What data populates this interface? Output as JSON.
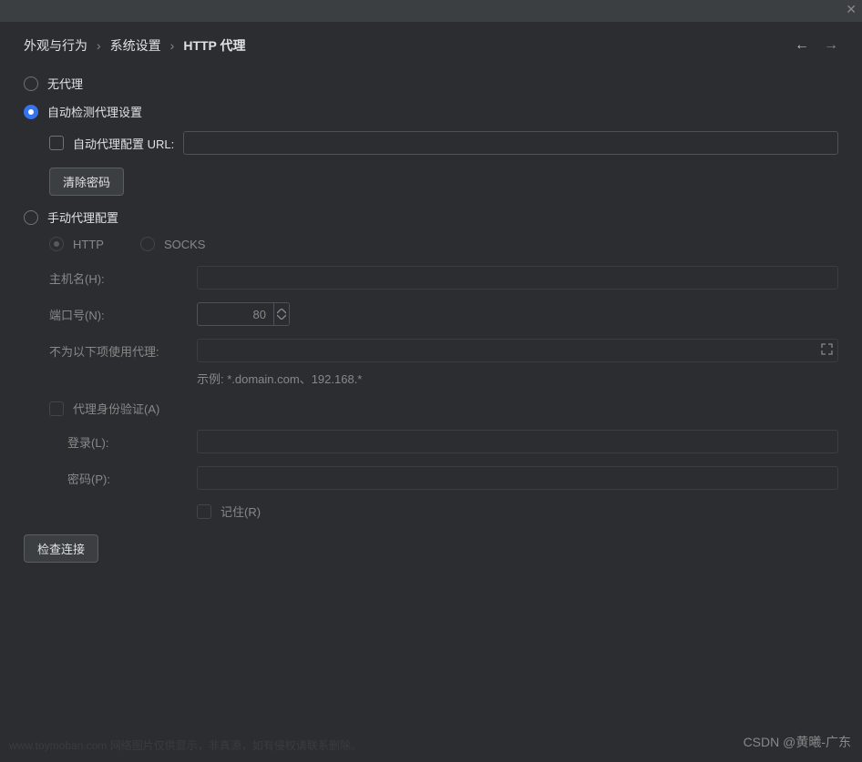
{
  "breadcrumb": {
    "level1": "外观与行为",
    "level2": "系统设置",
    "level3": "HTTP 代理",
    "sep": "›"
  },
  "proxy": {
    "noProxy": "无代理",
    "autoDetect": "自动检测代理设置",
    "manual": "手动代理配置",
    "autoConfigUrl": "自动代理配置 URL:",
    "clearPasswords": "清除密码",
    "http": "HTTP",
    "socks": "SOCKS",
    "hostName": "主机名(H):",
    "port": "端口号(N):",
    "portValue": "80",
    "noProxyFor": "不为以下项使用代理:",
    "example": "示例: *.domain.com、192.168.*",
    "auth": "代理身份验证(A)",
    "login": "登录(L):",
    "password": "密码(P):",
    "remember": "记住(R)",
    "checkConnection": "检查连接"
  },
  "watermark": "CSDN @黄曦-广东",
  "faintText": "www.toymoban.com 网络图片仅供显示，非真源，如有侵权请联系删除。"
}
